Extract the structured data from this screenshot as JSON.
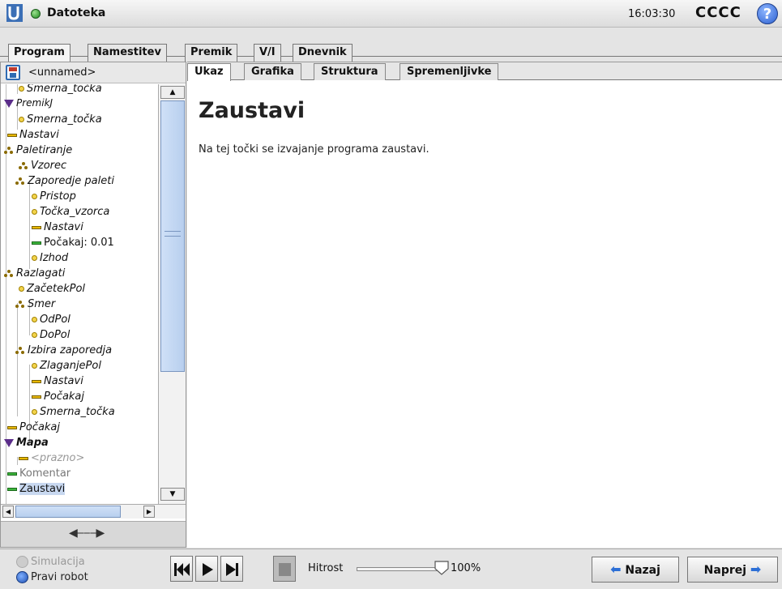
{
  "header": {
    "title": "Datoteka",
    "time": "16:03:30",
    "robot_name": "CCCC",
    "help": "?"
  },
  "main_tabs": [
    "Program",
    "Namestitev",
    "Premik",
    "V/I",
    "Dnevnik"
  ],
  "left": {
    "program_name": "<unnamed>",
    "tree": [
      "Smerna_točka",
      "PremikJ",
      "Smerna_točka",
      "Nastavi",
      "Paletiranje",
      "Vzorec",
      "Zaporedje paleti",
      "Pristop",
      "Točka_vzorca",
      "Nastavi",
      "Počakaj: 0.01",
      "Izhod",
      "Razlagati",
      "ZačetekPol",
      "Smer",
      "OdPol",
      "DoPol",
      "Izbira zaporedja",
      "ZlaganjePol",
      "Nastavi",
      "Počakaj",
      "Smerna_točka",
      "Počakaj",
      "Mapa",
      "<prazno>",
      "Komentar",
      "Zaustavi"
    ]
  },
  "sub_tabs": [
    "Ukaz",
    "Grafika",
    "Struktura",
    "Spremenljivke"
  ],
  "content": {
    "title": "Zaustavi",
    "description": "Na tej točki se izvajanje programa zaustavi."
  },
  "footer": {
    "simulation": "Simulacija",
    "real_robot": "Pravi robot",
    "speed_label": "Hitrost",
    "speed_value": "100%",
    "speed_fraction": 1.0,
    "back": "Nazaj",
    "next": "Naprej"
  },
  "colors": {
    "accent": "#2c6fd6",
    "waypoint": "#f3d44b",
    "set_bar": "#e8b800",
    "green_bar": "#3cb43c",
    "move_triangle": "#5b2d8a"
  }
}
